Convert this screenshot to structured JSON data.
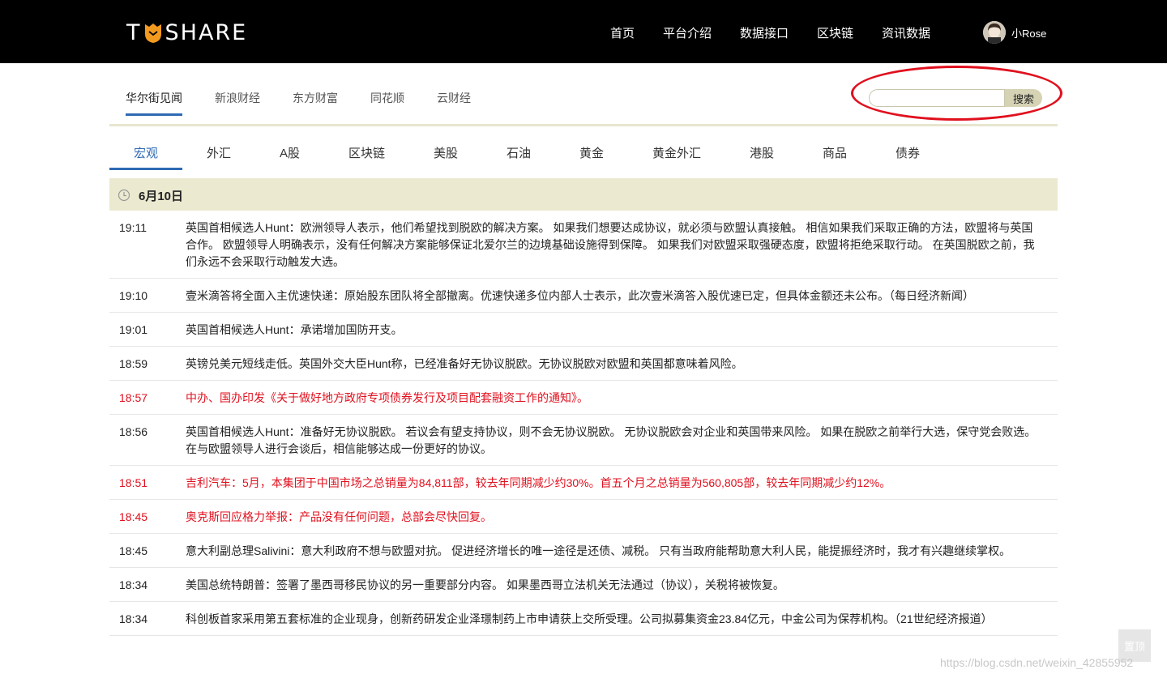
{
  "header": {
    "logo_left": "T",
    "logo_right": "SHARE",
    "nav": [
      "首页",
      "平台介绍",
      "数据接口",
      "区块链",
      "资讯数据"
    ],
    "username": "小Rose"
  },
  "source_tabs": [
    "华尔街见闻",
    "新浪财经",
    "东方财富",
    "同花顺",
    "云财经"
  ],
  "search": {
    "button_label": "搜索",
    "value": ""
  },
  "category_tabs": [
    "宏观",
    "外汇",
    "A股",
    "区块链",
    "美股",
    "石油",
    "黄金",
    "黄金外汇",
    "港股",
    "商品",
    "债券"
  ],
  "date_label": "6月10日",
  "news": [
    {
      "time": "19:11",
      "text": "英国首相候选人Hunt：欧洲领导人表示，他们希望找到脱欧的解决方案。 如果我们想要达成协议，就必须与欧盟认真接触。 相信如果我们采取正确的方法，欧盟将与英国合作。 欧盟领导人明确表示，没有任何解决方案能够保证北爱尔兰的边境基础设施得到保障。 如果我们对欧盟采取强硬态度，欧盟将拒绝采取行动。 在英国脱欧之前，我们永远不会采取行动触发大选。",
      "highlight": false
    },
    {
      "time": "19:10",
      "text": "壹米滴答将全面入主优速快递：原始股东团队将全部撤离。优速快递多位内部人士表示，此次壹米滴答入股优速已定，但具体金额还未公布。（每日经济新闻）",
      "highlight": false
    },
    {
      "time": "19:01",
      "text": "英国首相候选人Hunt：承诺增加国防开支。",
      "highlight": false
    },
    {
      "time": "18:59",
      "text": "英镑兑美元短线走低。英国外交大臣Hunt称，已经准备好无协议脱欧。无协议脱欧对欧盟和英国都意味着风险。",
      "highlight": false
    },
    {
      "time": "18:57",
      "text": "中办、国办印发《关于做好地方政府专项债券发行及项目配套融资工作的通知》。",
      "highlight": true
    },
    {
      "time": "18:56",
      "text": "英国首相候选人Hunt：准备好无协议脱欧。 若议会有望支持协议，则不会无协议脱欧。 无协议脱欧会对企业和英国带来风险。 如果在脱欧之前举行大选，保守党会败选。 在与欧盟领导人进行会谈后，相信能够达成一份更好的协议。",
      "highlight": false
    },
    {
      "time": "18:51",
      "text": "吉利汽车：5月，本集团于中国市场之总销量为84,811部，较去年同期减少约30%。首五个月之总销量为560,805部，较去年同期减少约12%。",
      "highlight": true
    },
    {
      "time": "18:45",
      "text": "奥克斯回应格力举报：产品没有任何问题，总部会尽快回复。",
      "highlight": true
    },
    {
      "time": "18:45",
      "text": "意大利副总理Salivini：意大利政府不想与欧盟对抗。 促进经济增长的唯一途径是还债、减税。 只有当政府能帮助意大利人民，能提振经济时，我才有兴趣继续掌权。",
      "highlight": false
    },
    {
      "time": "18:34",
      "text": "美国总统特朗普：签署了墨西哥移民协议的另一重要部分内容。 如果墨西哥立法机关无法通过（协议），关税将被恢复。",
      "highlight": false
    },
    {
      "time": "18:34",
      "text": "科创板首家采用第五套标准的企业现身，创新药研发企业泽璟制药上市申请获上交所受理。公司拟募集资金23.84亿元，中金公司为保荐机构。（21世纪经济报道）",
      "highlight": false
    }
  ],
  "back_to_top": "置顶",
  "watermark": "https://blog.csdn.net/weixin_42855952",
  "colors": {
    "accent": "#2e6ab3",
    "highlight": "#e0101e",
    "date_bar": "#ebead1",
    "header_bg": "#000000"
  }
}
